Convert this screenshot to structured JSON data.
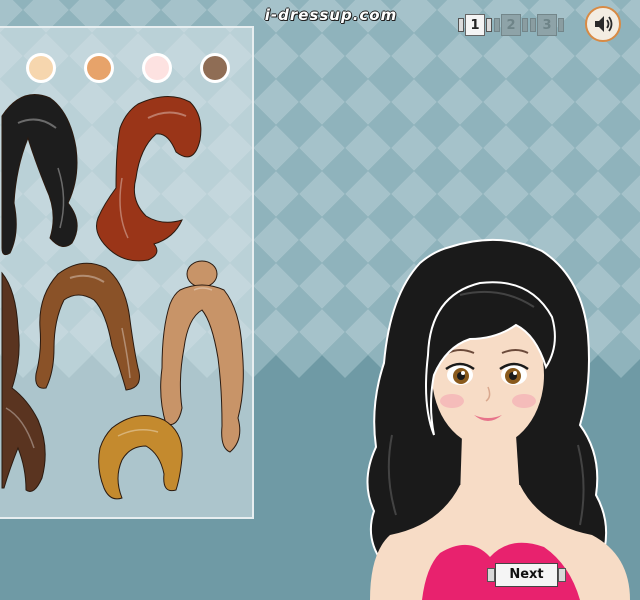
{
  "header": {
    "site_logo": "i-dressup.com",
    "pages": [
      {
        "label": "1",
        "active": true
      },
      {
        "label": "2",
        "active": false
      },
      {
        "label": "3",
        "active": false
      }
    ],
    "sound_icon": "speaker-icon"
  },
  "skin_tones": [
    "#f6d6ae",
    "#e7a36a",
    "#fde2e1",
    "#8f6d55"
  ],
  "hair_options": [
    {
      "name": "long-black-wavy",
      "color": "#1d1d1d"
    },
    {
      "name": "red-side-swept",
      "color": "#9a3518"
    },
    {
      "name": "dark-brown-braid",
      "color": "#5a3420"
    },
    {
      "name": "brown-long-wavy",
      "color": "#8a5228"
    },
    {
      "name": "light-brown-bun",
      "color": "#c89468"
    },
    {
      "name": "golden-bob",
      "color": "#c48a2e"
    }
  ],
  "model": {
    "hair_color": "#1a1a1a",
    "skin_color": "#f7dcc6",
    "top_color": "#e8226e"
  },
  "footer": {
    "next_label": "Next"
  }
}
